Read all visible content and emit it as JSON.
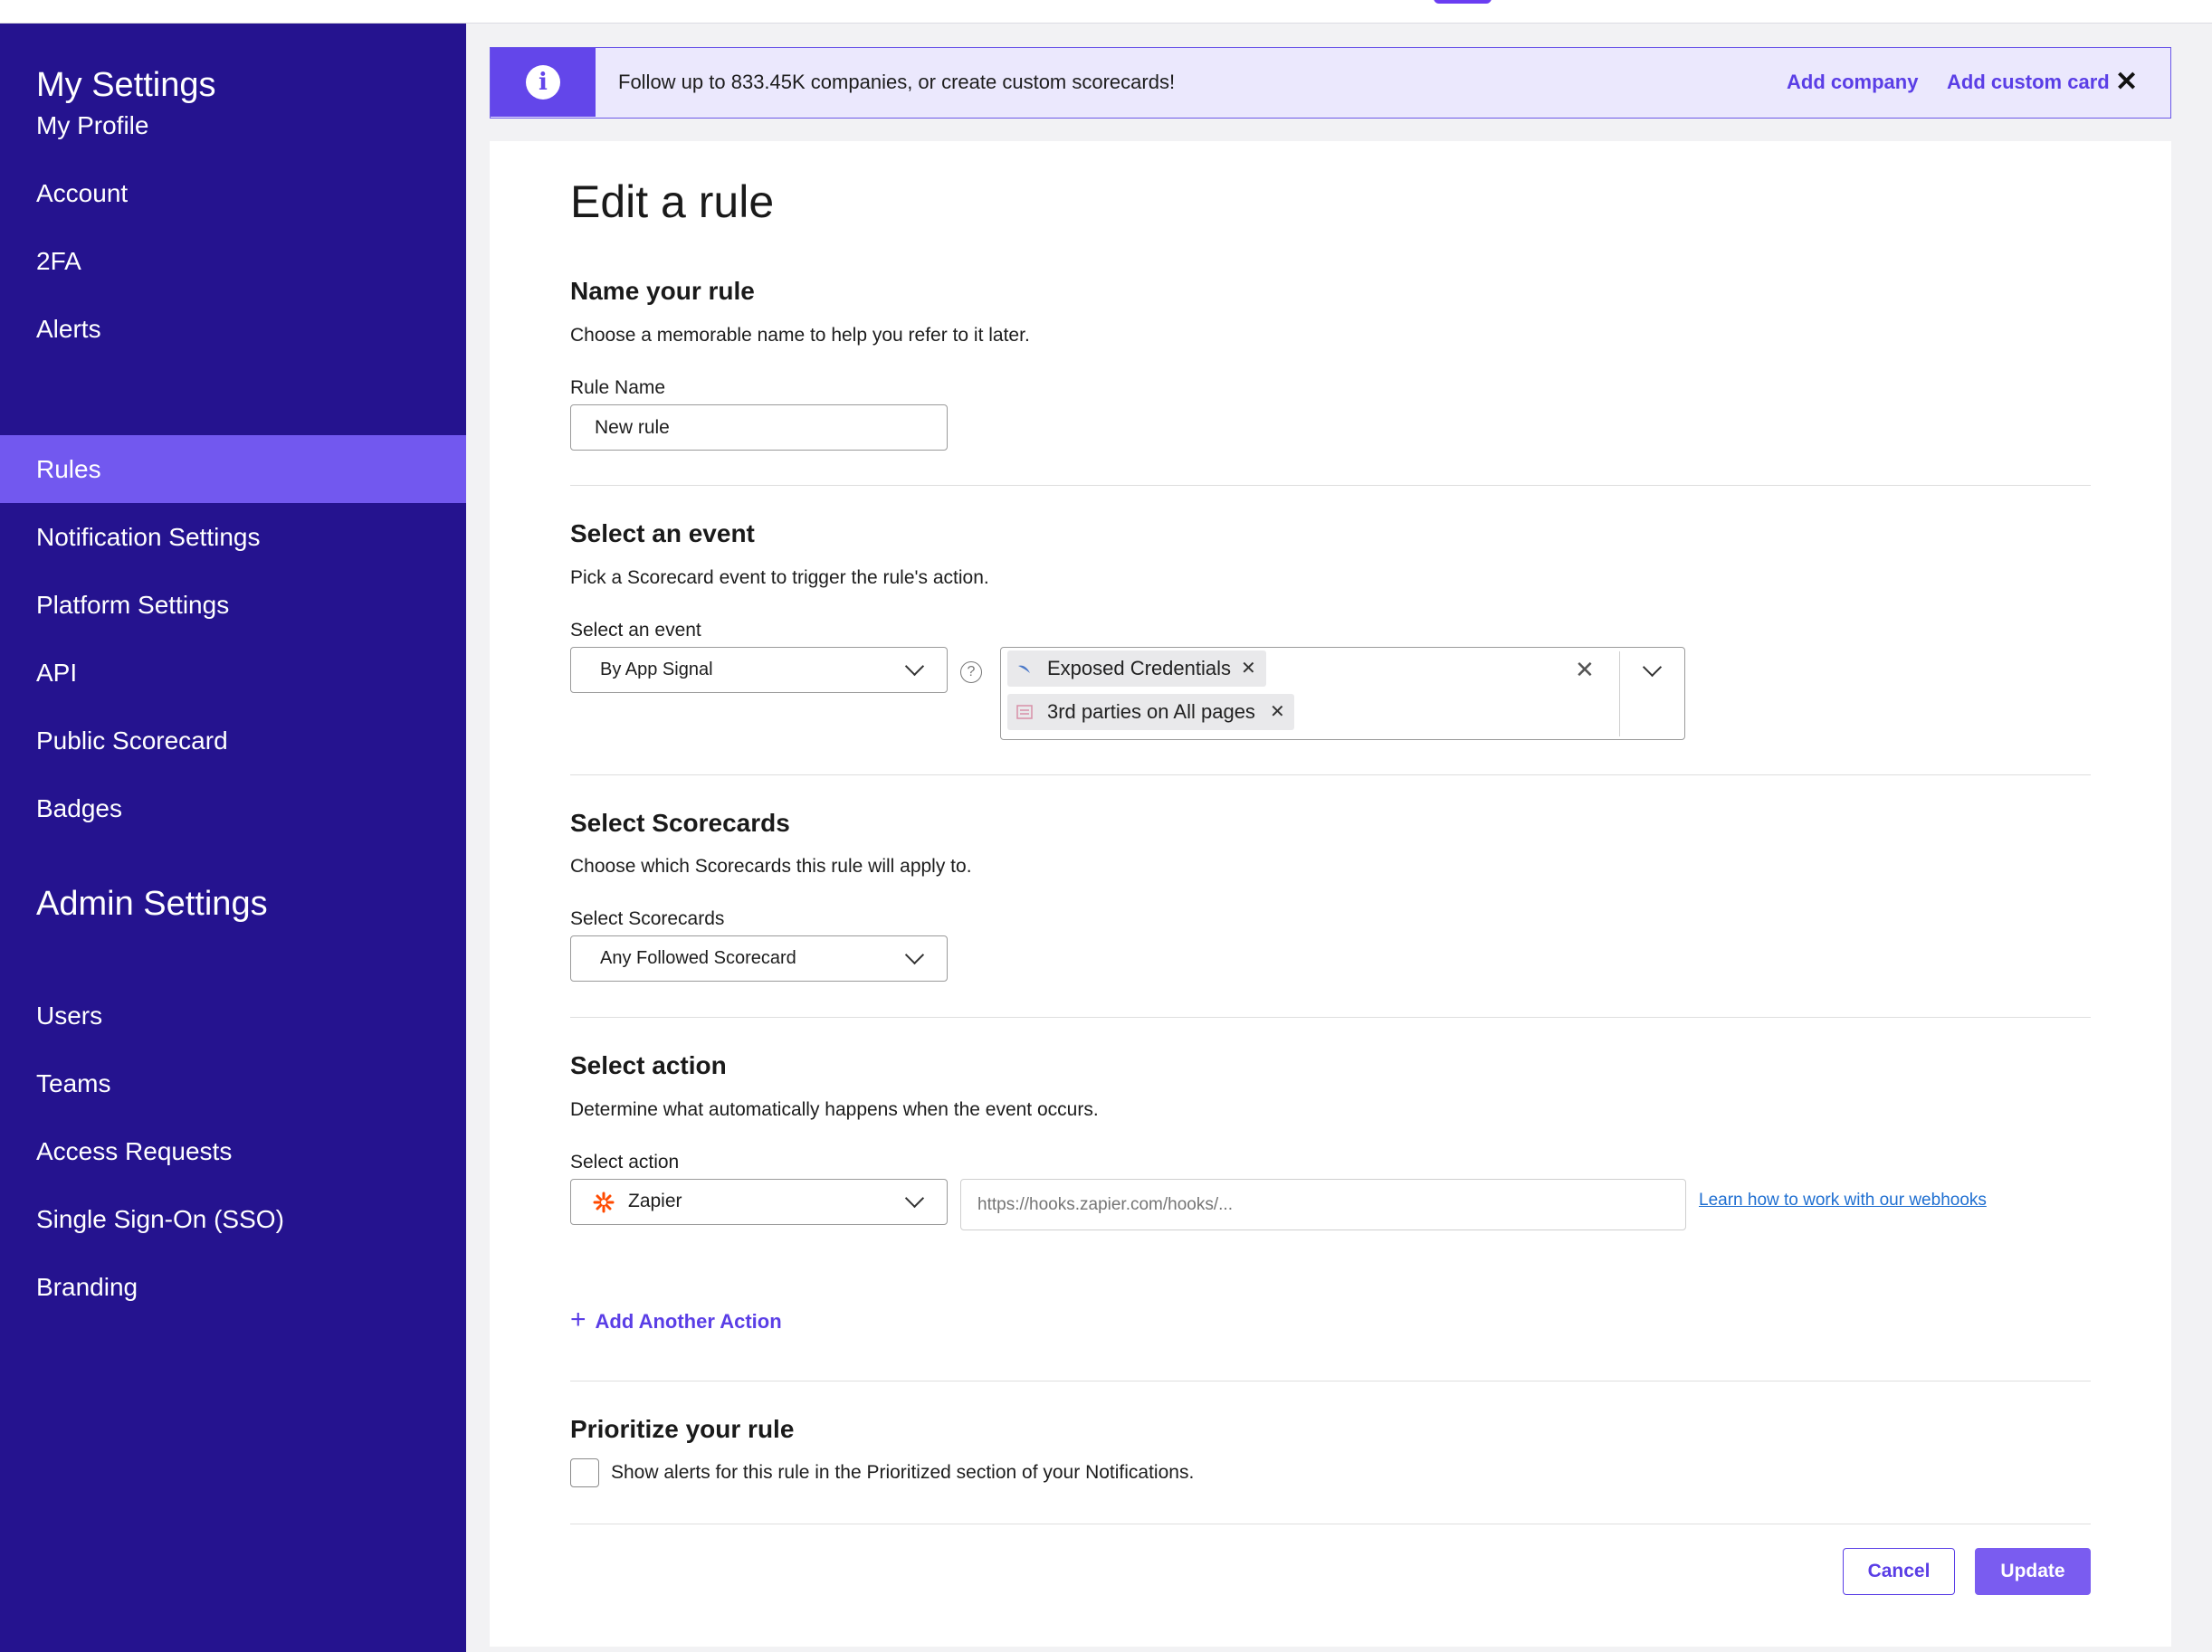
{
  "sidebar": {
    "my_settings_title": "My Settings",
    "my_items": [
      {
        "label": "My Profile"
      },
      {
        "label": "Account"
      },
      {
        "label": "2FA"
      },
      {
        "label": "Alerts"
      },
      {
        "label": "Rules",
        "active": true
      },
      {
        "label": "Notification Settings"
      },
      {
        "label": "Platform Settings"
      },
      {
        "label": "API"
      },
      {
        "label": "Public Scorecard"
      },
      {
        "label": "Badges"
      }
    ],
    "admin_settings_title": "Admin Settings",
    "admin_items": [
      {
        "label": "Users"
      },
      {
        "label": "Teams"
      },
      {
        "label": "Access Requests"
      },
      {
        "label": "Single Sign-On (SSO)"
      },
      {
        "label": "Branding"
      }
    ],
    "background_color": "#25138f",
    "active_color": "#7258ef"
  },
  "banner": {
    "icon": "info-icon",
    "message": "Follow up to 833.45K companies, or create custom scorecards!",
    "add_company_label": "Add company",
    "add_custom_card_label": "Add custom card",
    "close_glyph": "✕"
  },
  "page": {
    "title": "Edit a rule"
  },
  "name_section": {
    "heading": "Name your rule",
    "description": "Choose a memorable name to help you refer to it later.",
    "field_label": "Rule Name",
    "field_value": "New rule"
  },
  "event_section": {
    "heading": "Select an event",
    "description": "Pick a Scorecard event to trigger the rule's action.",
    "field_label": "Select an event",
    "selected_value": "By App Signal",
    "help_glyph": "?",
    "tags": [
      {
        "label": "Exposed Credentials",
        "icon": "credentials-icon"
      },
      {
        "label": "3rd parties on All pages",
        "icon": "third-parties-icon"
      }
    ],
    "clear_glyph": "✕",
    "remove_glyph": "✕"
  },
  "scorecards_section": {
    "heading": "Select Scorecards",
    "description": "Choose which Scorecards this rule will apply to.",
    "field_label": "Select Scorecards",
    "selected_value": "Any Followed Scorecard"
  },
  "action_section": {
    "heading": "Select action",
    "description": "Determine what automatically happens when the event occurs.",
    "field_label": "Select action",
    "selected_value": "Zapier",
    "selected_icon": "zapier-icon",
    "webhook_placeholder": "https://hooks.zapier.com/hooks/...",
    "webhook_link": "Learn how to work with our webhooks",
    "add_another_label": "Add Another Action",
    "add_glyph": "+"
  },
  "priority_section": {
    "heading": "Prioritize your rule",
    "checkbox_label": "Show alerts for this rule in the Prioritized section of your Notifications.",
    "checked": false
  },
  "footer": {
    "cancel_label": "Cancel",
    "update_label": "Update"
  },
  "colors": {
    "accent": "#5a3ee6",
    "link": "#1f6fd1",
    "banner_bg": "#ebe8fd"
  }
}
